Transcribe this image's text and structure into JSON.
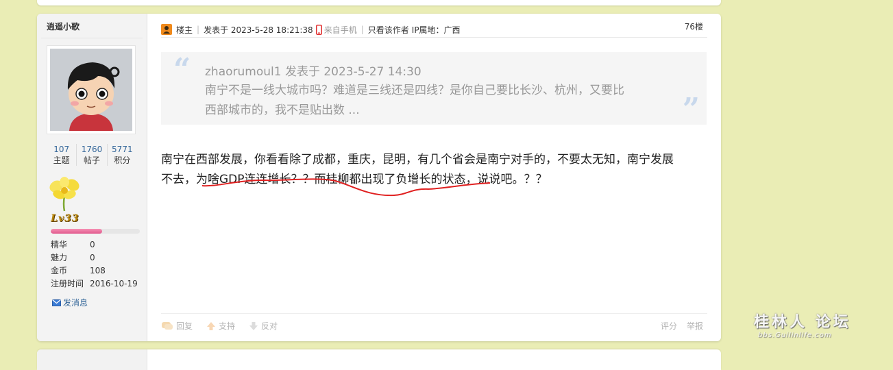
{
  "post": {
    "author": "逍遥小歌",
    "stats": [
      {
        "value": "107",
        "label": "主题"
      },
      {
        "value": "1760",
        "label": "帖子"
      },
      {
        "value": "5771",
        "label": "积分"
      }
    ],
    "level": "Lv33",
    "level_progress": 0.58,
    "info": [
      {
        "key": "精华",
        "value": "0"
      },
      {
        "key": "魅力",
        "value": "0"
      },
      {
        "key": "金币",
        "value": "108"
      },
      {
        "key": "注册时间",
        "value": "2016-10-19"
      }
    ],
    "send_message": "发消息",
    "header": {
      "louzhu": "楼主",
      "posted_at": "发表于 2023-5-28 18:21:38",
      "from_mobile": "来自手机",
      "only_author": "只看该作者",
      "ip_location": "IP属地：广西",
      "floor": "76楼"
    },
    "quote": {
      "author_line": "zhaorumoul1 发表于 2023-5-27 14:30",
      "line1": "南宁不是一线大城市吗？难道是三线还是四线？是你自己要比长沙、杭州，又要比",
      "line2": "西部城市的，我不是贴出数 ..."
    },
    "content": {
      "line1": "南宁在西部发展，你看看除了成都，重庆，昆明，有几个省会是南宁对手的，不要太无知，南宁发展",
      "line2": "不去，为啥GDP连连增长？？而桂柳都出现了负增长的状态，说说吧。？？"
    },
    "actions": {
      "reply": "回复",
      "support": "支持",
      "oppose": "反对",
      "rate": "评分",
      "report": "举报"
    }
  },
  "watermark": {
    "main": "桂林人 论坛",
    "sub": "bbs.Guilinlife.com"
  },
  "colors": {
    "page_bg": "#eaedb5",
    "link": "#336699",
    "quote_mark": "#c8d8ec",
    "annotation": "#e02020"
  }
}
